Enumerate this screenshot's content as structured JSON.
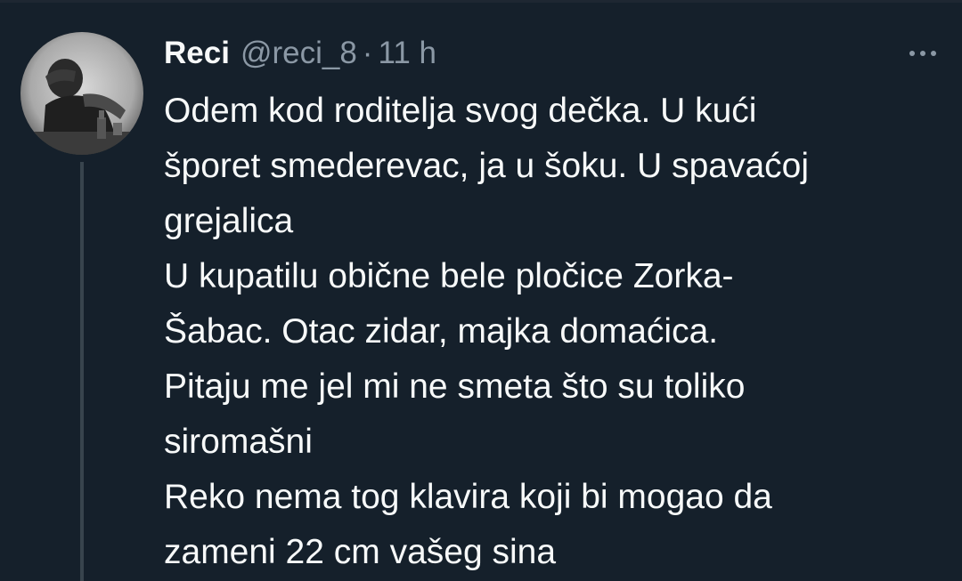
{
  "tweet": {
    "display_name": "Reci",
    "handle": "@reci_8",
    "separator": "·",
    "time": "11 h",
    "lines": [
      "Odem kod roditelja svog dečka. U kući",
      "šporet smederevac, ja u šoku. U spavaćoj",
      "grejalica",
      "U kupatilu obične bele pločice Zorka-",
      "Šabac. Otac zidar, majka domaćica.",
      "Pitaju me jel mi ne smeta što su toliko",
      "siromašni",
      "Reko nema tog klavira koji bi mogao da",
      "zameni 22 cm vašeg sina"
    ]
  },
  "icons": {
    "avatar": "profile-photo",
    "more": "more-horizontal-icon"
  },
  "colors": {
    "background": "#15202b",
    "text_primary": "#f7f9f9",
    "text_secondary": "#8b98a5",
    "thread_line": "#38444d"
  }
}
